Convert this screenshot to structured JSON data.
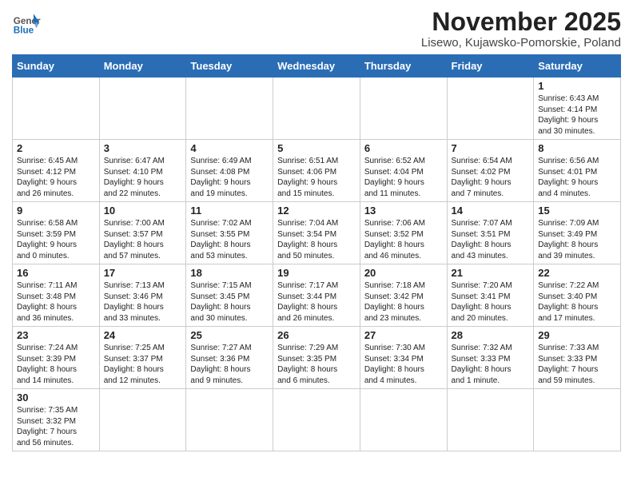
{
  "header": {
    "logo_general": "General",
    "logo_blue": "Blue",
    "month_title": "November 2025",
    "location": "Lisewo, Kujawsko-Pomorskie, Poland"
  },
  "weekdays": [
    "Sunday",
    "Monday",
    "Tuesday",
    "Wednesday",
    "Thursday",
    "Friday",
    "Saturday"
  ],
  "weeks": [
    [
      {
        "day": "",
        "info": ""
      },
      {
        "day": "",
        "info": ""
      },
      {
        "day": "",
        "info": ""
      },
      {
        "day": "",
        "info": ""
      },
      {
        "day": "",
        "info": ""
      },
      {
        "day": "",
        "info": ""
      },
      {
        "day": "1",
        "info": "Sunrise: 6:43 AM\nSunset: 4:14 PM\nDaylight: 9 hours\nand 30 minutes."
      }
    ],
    [
      {
        "day": "2",
        "info": "Sunrise: 6:45 AM\nSunset: 4:12 PM\nDaylight: 9 hours\nand 26 minutes."
      },
      {
        "day": "3",
        "info": "Sunrise: 6:47 AM\nSunset: 4:10 PM\nDaylight: 9 hours\nand 22 minutes."
      },
      {
        "day": "4",
        "info": "Sunrise: 6:49 AM\nSunset: 4:08 PM\nDaylight: 9 hours\nand 19 minutes."
      },
      {
        "day": "5",
        "info": "Sunrise: 6:51 AM\nSunset: 4:06 PM\nDaylight: 9 hours\nand 15 minutes."
      },
      {
        "day": "6",
        "info": "Sunrise: 6:52 AM\nSunset: 4:04 PM\nDaylight: 9 hours\nand 11 minutes."
      },
      {
        "day": "7",
        "info": "Sunrise: 6:54 AM\nSunset: 4:02 PM\nDaylight: 9 hours\nand 7 minutes."
      },
      {
        "day": "8",
        "info": "Sunrise: 6:56 AM\nSunset: 4:01 PM\nDaylight: 9 hours\nand 4 minutes."
      }
    ],
    [
      {
        "day": "9",
        "info": "Sunrise: 6:58 AM\nSunset: 3:59 PM\nDaylight: 9 hours\nand 0 minutes."
      },
      {
        "day": "10",
        "info": "Sunrise: 7:00 AM\nSunset: 3:57 PM\nDaylight: 8 hours\nand 57 minutes."
      },
      {
        "day": "11",
        "info": "Sunrise: 7:02 AM\nSunset: 3:55 PM\nDaylight: 8 hours\nand 53 minutes."
      },
      {
        "day": "12",
        "info": "Sunrise: 7:04 AM\nSunset: 3:54 PM\nDaylight: 8 hours\nand 50 minutes."
      },
      {
        "day": "13",
        "info": "Sunrise: 7:06 AM\nSunset: 3:52 PM\nDaylight: 8 hours\nand 46 minutes."
      },
      {
        "day": "14",
        "info": "Sunrise: 7:07 AM\nSunset: 3:51 PM\nDaylight: 8 hours\nand 43 minutes."
      },
      {
        "day": "15",
        "info": "Sunrise: 7:09 AM\nSunset: 3:49 PM\nDaylight: 8 hours\nand 39 minutes."
      }
    ],
    [
      {
        "day": "16",
        "info": "Sunrise: 7:11 AM\nSunset: 3:48 PM\nDaylight: 8 hours\nand 36 minutes."
      },
      {
        "day": "17",
        "info": "Sunrise: 7:13 AM\nSunset: 3:46 PM\nDaylight: 8 hours\nand 33 minutes."
      },
      {
        "day": "18",
        "info": "Sunrise: 7:15 AM\nSunset: 3:45 PM\nDaylight: 8 hours\nand 30 minutes."
      },
      {
        "day": "19",
        "info": "Sunrise: 7:17 AM\nSunset: 3:44 PM\nDaylight: 8 hours\nand 26 minutes."
      },
      {
        "day": "20",
        "info": "Sunrise: 7:18 AM\nSunset: 3:42 PM\nDaylight: 8 hours\nand 23 minutes."
      },
      {
        "day": "21",
        "info": "Sunrise: 7:20 AM\nSunset: 3:41 PM\nDaylight: 8 hours\nand 20 minutes."
      },
      {
        "day": "22",
        "info": "Sunrise: 7:22 AM\nSunset: 3:40 PM\nDaylight: 8 hours\nand 17 minutes."
      }
    ],
    [
      {
        "day": "23",
        "info": "Sunrise: 7:24 AM\nSunset: 3:39 PM\nDaylight: 8 hours\nand 14 minutes."
      },
      {
        "day": "24",
        "info": "Sunrise: 7:25 AM\nSunset: 3:37 PM\nDaylight: 8 hours\nand 12 minutes."
      },
      {
        "day": "25",
        "info": "Sunrise: 7:27 AM\nSunset: 3:36 PM\nDaylight: 8 hours\nand 9 minutes."
      },
      {
        "day": "26",
        "info": "Sunrise: 7:29 AM\nSunset: 3:35 PM\nDaylight: 8 hours\nand 6 minutes."
      },
      {
        "day": "27",
        "info": "Sunrise: 7:30 AM\nSunset: 3:34 PM\nDaylight: 8 hours\nand 4 minutes."
      },
      {
        "day": "28",
        "info": "Sunrise: 7:32 AM\nSunset: 3:33 PM\nDaylight: 8 hours\nand 1 minute."
      },
      {
        "day": "29",
        "info": "Sunrise: 7:33 AM\nSunset: 3:33 PM\nDaylight: 7 hours\nand 59 minutes."
      }
    ],
    [
      {
        "day": "30",
        "info": "Sunrise: 7:35 AM\nSunset: 3:32 PM\nDaylight: 7 hours\nand 56 minutes."
      },
      {
        "day": "",
        "info": ""
      },
      {
        "day": "",
        "info": ""
      },
      {
        "day": "",
        "info": ""
      },
      {
        "day": "",
        "info": ""
      },
      {
        "day": "",
        "info": ""
      },
      {
        "day": "",
        "info": ""
      }
    ]
  ]
}
